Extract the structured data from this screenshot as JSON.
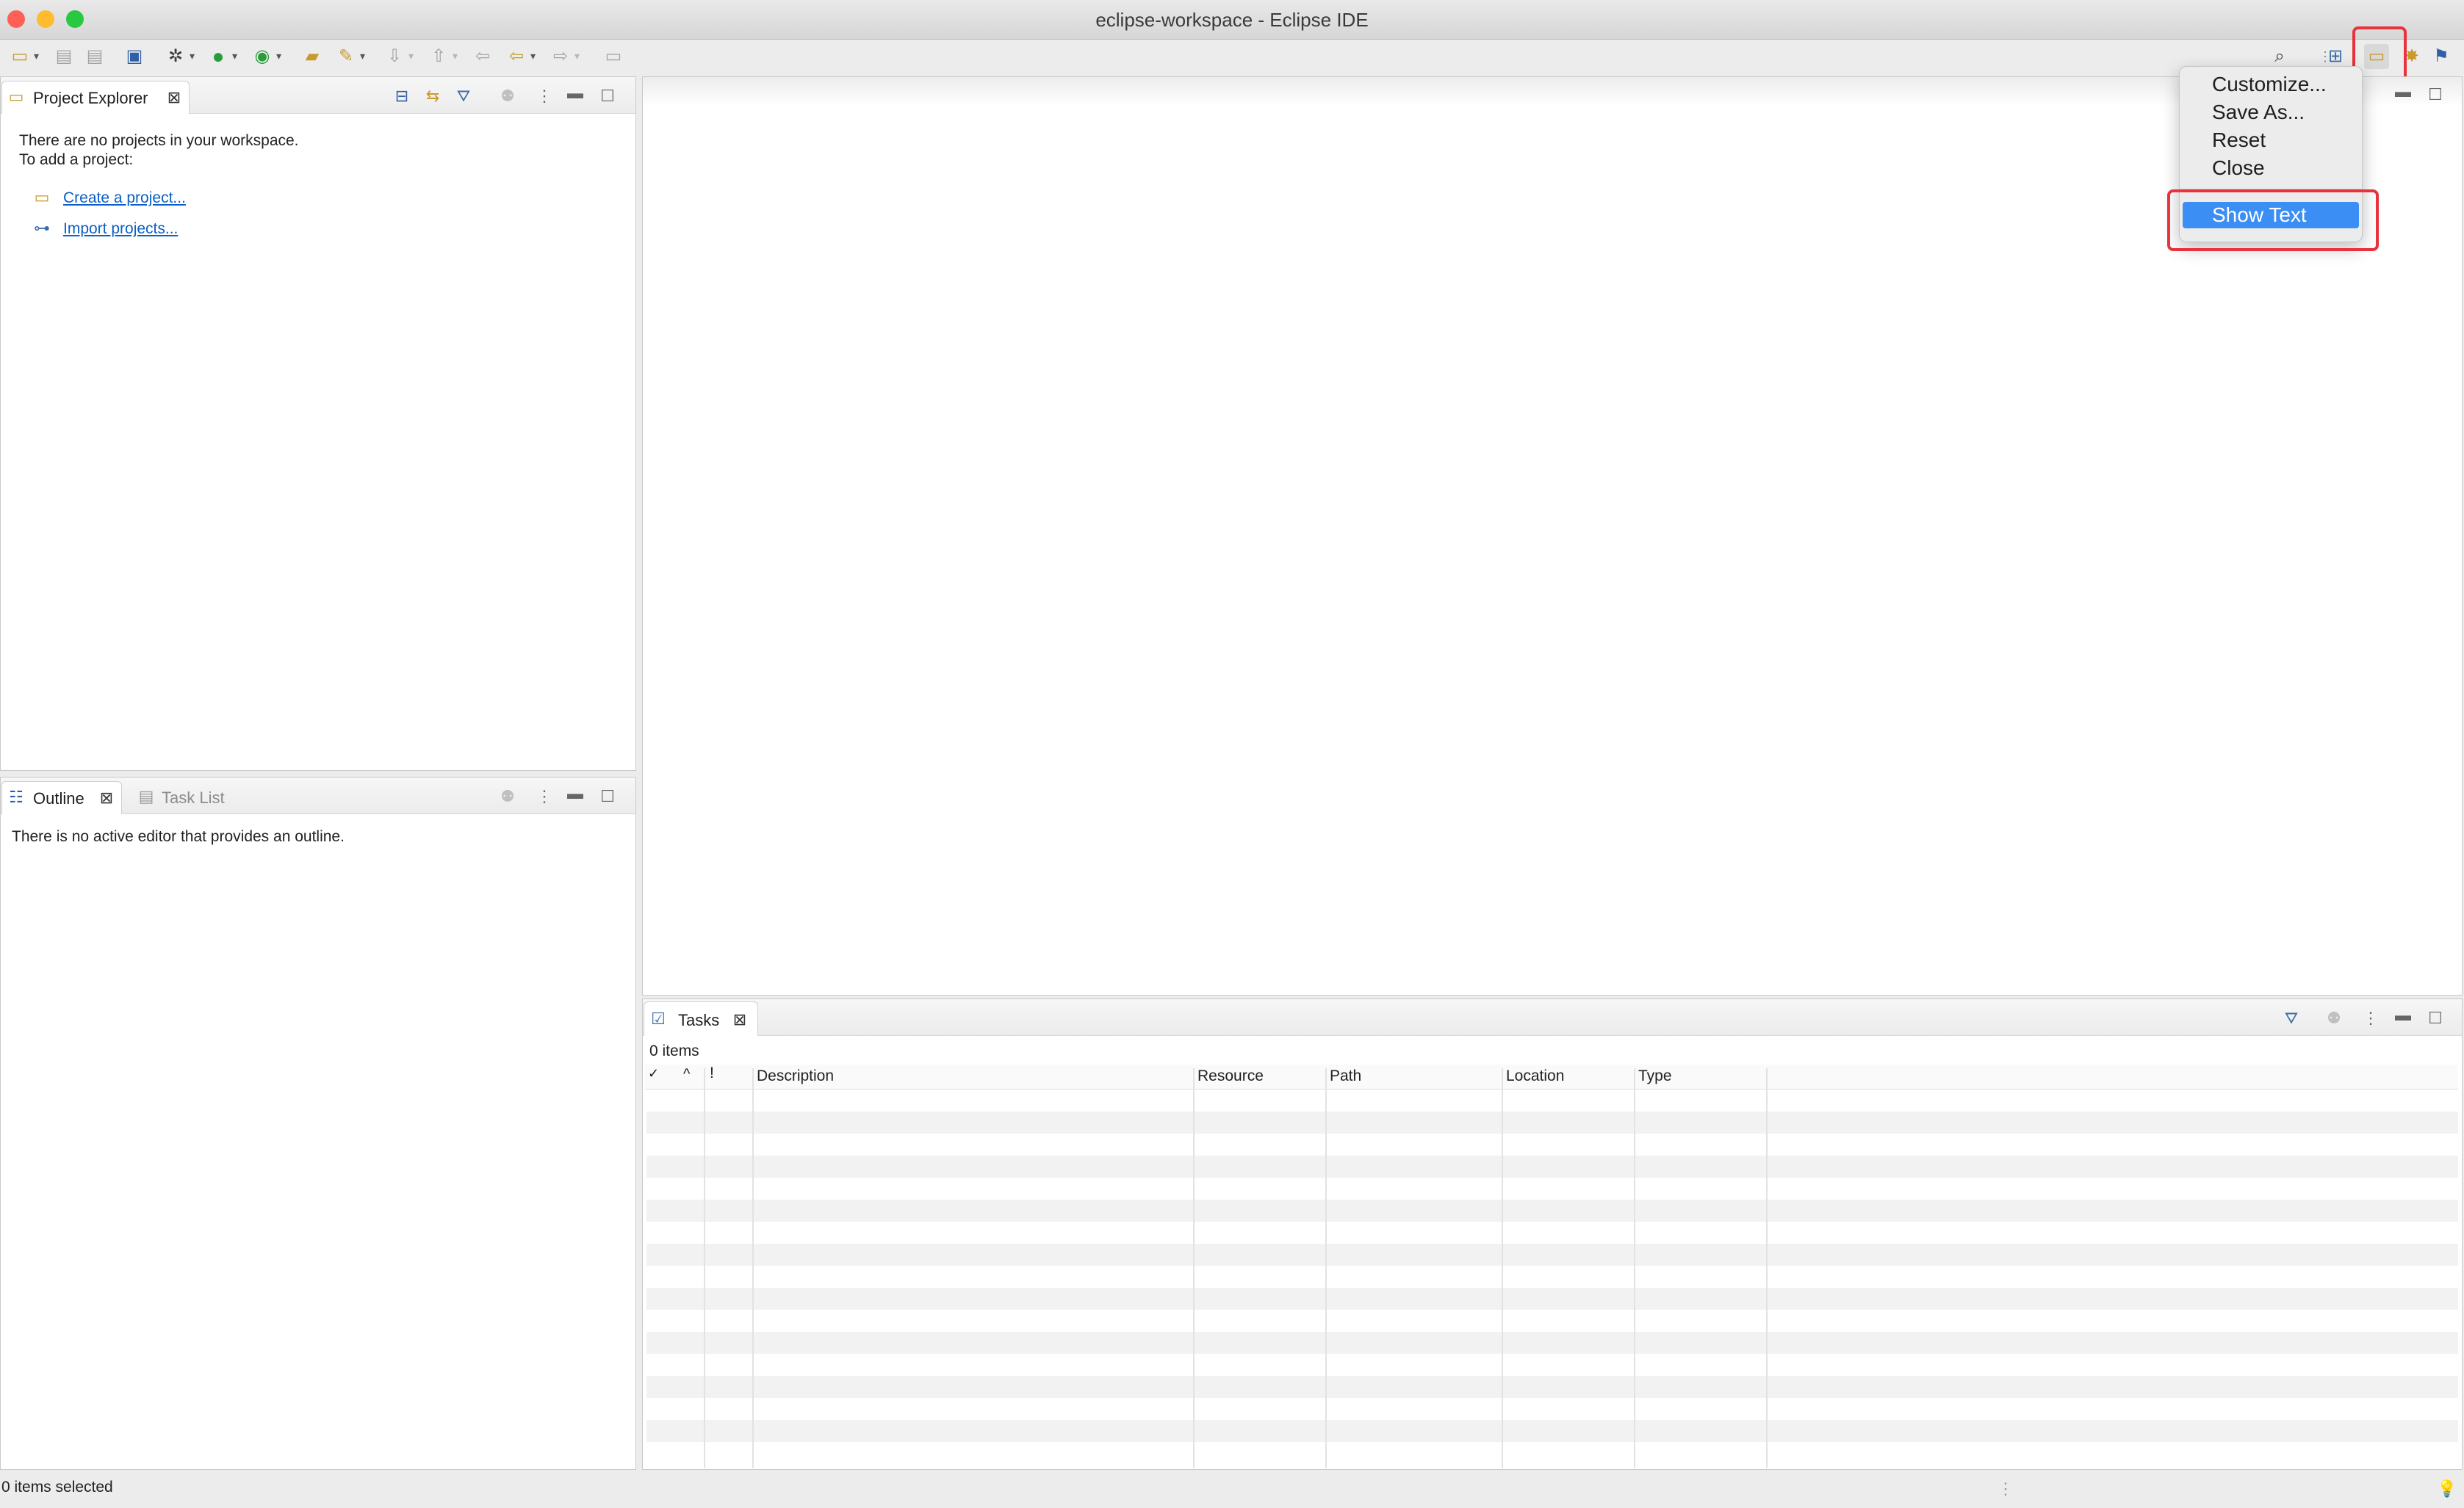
{
  "window": {
    "title": "eclipse-workspace - Eclipse IDE"
  },
  "colors": {
    "accent": "#3b8ef3",
    "highlight_box": "#e8323c",
    "link": "#0b5fc6"
  },
  "toolbar": {
    "left_icons": [
      "new-wizard-icon",
      "save-icon",
      "save-all-icon",
      "terminal-icon",
      "debug-icon",
      "run-icon",
      "external-tools-icon",
      "open-type-icon",
      "search-tool-icon",
      "next-annotation-icon",
      "previous-annotation-icon",
      "back-icon",
      "forward-icon",
      "pin-editor-icon"
    ],
    "right_icons": [
      "search-icon",
      "open-perspective-icon",
      "resource-perspective-icon",
      "debug-perspective-icon",
      "java-perspective-icon"
    ]
  },
  "project_explorer": {
    "tab_label": "Project Explorer",
    "message_line1": "There are no projects in your workspace.",
    "message_line2": "To add a project:",
    "links": [
      {
        "label": "Create a project...",
        "icon": "new-project-icon"
      },
      {
        "label": "Import projects...",
        "icon": "import-icon"
      }
    ]
  },
  "outline": {
    "tab_label": "Outline",
    "second_tab_label": "Task List",
    "message": "There is no active editor that provides an outline."
  },
  "tasks": {
    "tab_label": "Tasks",
    "count_text": "0 items",
    "columns": [
      "✓",
      "^",
      "!",
      "Description",
      "Resource",
      "Path",
      "Location",
      "Type"
    ]
  },
  "perspective_menu": {
    "items": [
      "Customize...",
      "Save As...",
      "Reset",
      "Close"
    ],
    "selected_item": "Show Text"
  },
  "status": {
    "text": "0 items selected"
  }
}
